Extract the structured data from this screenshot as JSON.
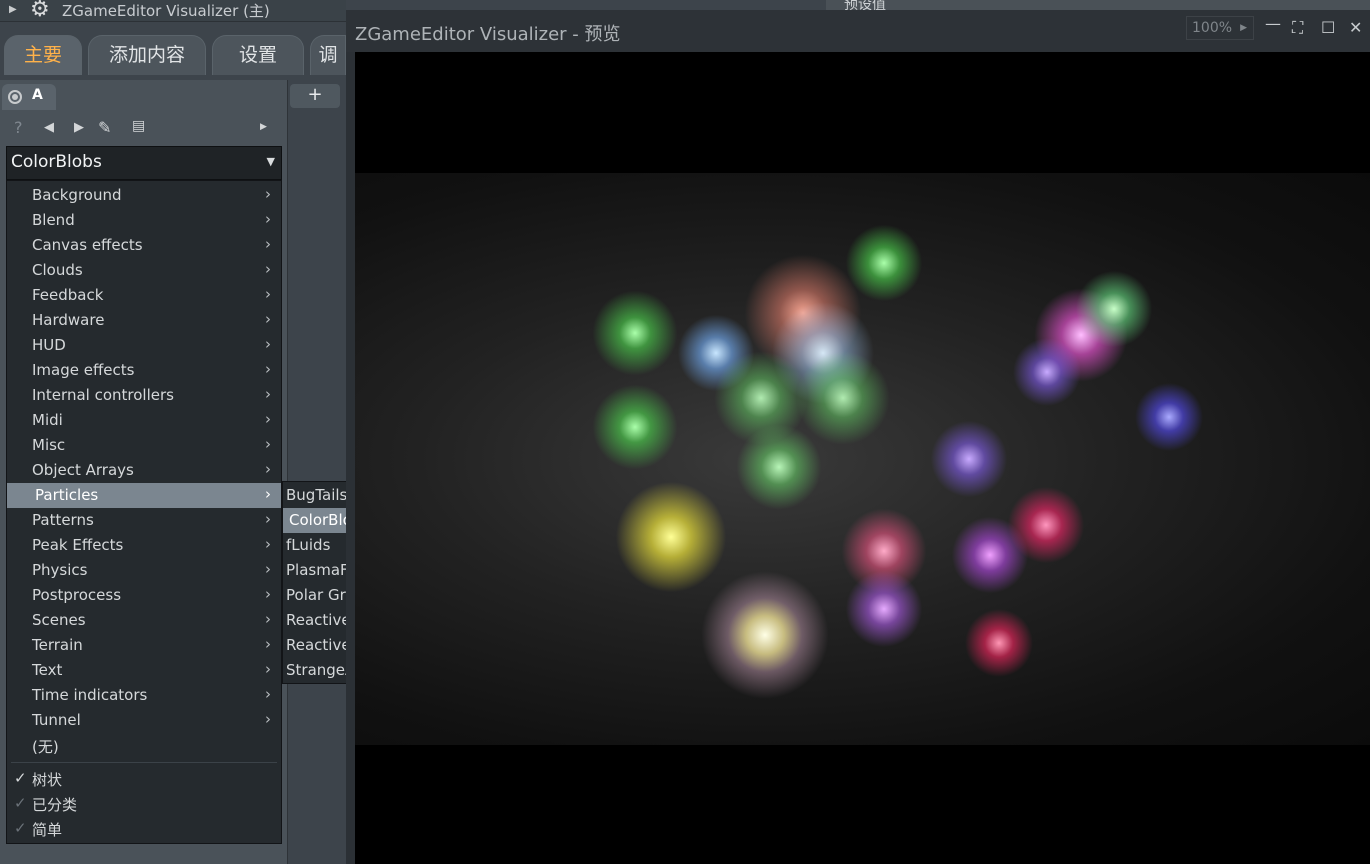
{
  "plugin_window": {
    "title": "ZGameEditor Visualizer (主)",
    "behind_label": "预设值",
    "tabs": [
      "主要",
      "添加内容",
      "设置",
      "调"
    ],
    "active_tab": "主要",
    "preset_tab": "A",
    "add_tab": "+"
  },
  "combo": {
    "value": "ColorBlobs"
  },
  "category_menu": {
    "items": [
      "Background",
      "Blend",
      "Canvas effects",
      "Clouds",
      "Feedback",
      "Hardware",
      "HUD",
      "Image effects",
      "Internal controllers",
      "Midi",
      "Misc",
      "Object Arrays",
      "Particles",
      "Patterns",
      "Peak Effects",
      "Physics",
      "Postprocess",
      "Scenes",
      "Terrain",
      "Text",
      "Time indicators",
      "Tunnel"
    ],
    "highlighted": "Particles",
    "none_item": "(无)",
    "view_options": [
      "树状",
      "已分类",
      "简单"
    ]
  },
  "submenu": {
    "items": [
      "BugTails",
      "ColorBlobs",
      "fLuids",
      "PlasmaFlys",
      "Polar Grid Motion",
      "ReactiveFlow",
      "ReactiveMob",
      "StrangeAcid"
    ],
    "highlighted": "ColorBlobs"
  },
  "preview_window": {
    "title": "ZGameEditor Visualizer - 预览",
    "zoom": "100%"
  },
  "colors": {
    "accent": "#ffb24a",
    "highlight": "#7b8690",
    "menu_bg": "#252a2e"
  }
}
